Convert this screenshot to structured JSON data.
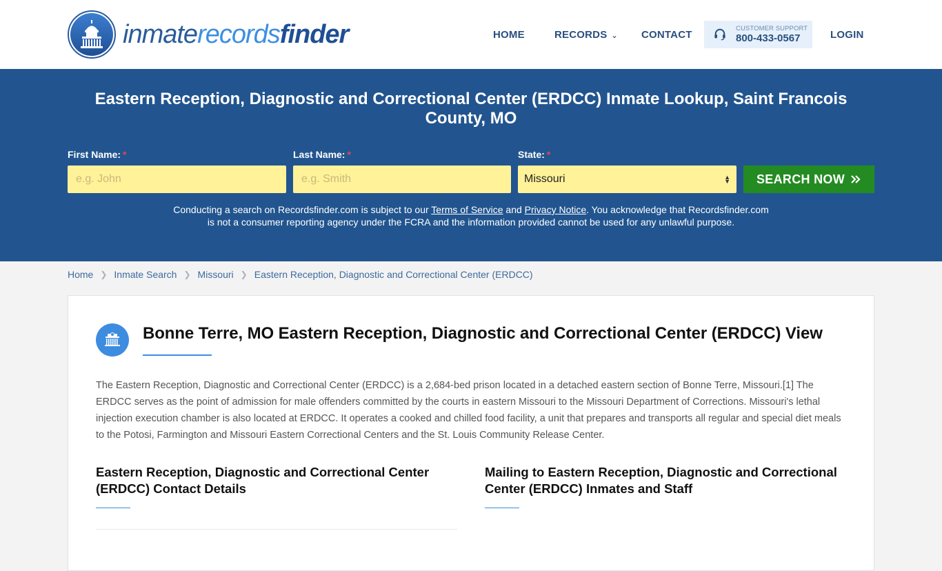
{
  "header": {
    "logo": {
      "part1": "inmate",
      "part2": "records",
      "part3": "finder"
    },
    "nav": {
      "home": "HOME",
      "records": "RECORDS",
      "contact": "CONTACT",
      "support_label": "CUSTOMER SUPPORT",
      "support_phone": "800-433-0567",
      "login": "LOGIN"
    }
  },
  "hero": {
    "title": "Eastern Reception, Diagnostic and Correctional Center (ERDCC) Inmate Lookup, Saint Francois County, MO",
    "form": {
      "first_name_label": "First Name:",
      "first_name_placeholder": "e.g. John",
      "last_name_label": "Last Name:",
      "last_name_placeholder": "e.g. Smith",
      "state_label": "State:",
      "state_value": "Missouri",
      "required_mark": "*",
      "search_button": "SEARCH NOW",
      "search_icon": "double-chevron-right"
    },
    "disclaimer": {
      "part1": "Conducting a search on Recordsfinder.com is subject to our ",
      "terms_link": "Terms of Service",
      "part2": " and ",
      "privacy_link": "Privacy Notice",
      "part3": ". You acknowledge that Recordsfinder.com is not a consumer reporting agency under the FCRA and the information provided cannot be used for any unlawful purpose."
    }
  },
  "breadcrumb": [
    {
      "label": "Home"
    },
    {
      "label": "Inmate Search"
    },
    {
      "label": "Missouri"
    },
    {
      "label": "Eastern Reception, Diagnostic and Correctional Center (ERDCC)"
    }
  ],
  "card": {
    "icon": "prison-building-icon",
    "title": "Bonne Terre, MO Eastern Reception, Diagnostic and Correctional Center (ERDCC) View",
    "body": "The Eastern Reception, Diagnostic and Correctional Center (ERDCC) is a 2,684-bed prison located in a detached eastern section of Bonne Terre, Missouri.[1] The ERDCC serves as the point of admission for male offenders committed by the courts in eastern Missouri to the Missouri Department of Corrections. Missouri's lethal injection execution chamber is also located at ERDCC. It operates a cooked and chilled food facility, a unit that prepares and transports all regular and special diet meals to the Potosi, Farmington and Missouri Eastern Correctional Centers and the St. Louis Community Release Center.",
    "contact_heading": "Eastern Reception, Diagnostic and Correctional Center (ERDCC) Contact Details",
    "mailing_heading": "Mailing to Eastern Reception, Diagnostic and Correctional Center (ERDCC) Inmates and Staff"
  },
  "colors": {
    "brand_blue": "#22558f",
    "accent_blue": "#3d8ce0",
    "input_yellow": "#fff299",
    "search_green": "#248b22",
    "required_red": "#e8425b"
  }
}
